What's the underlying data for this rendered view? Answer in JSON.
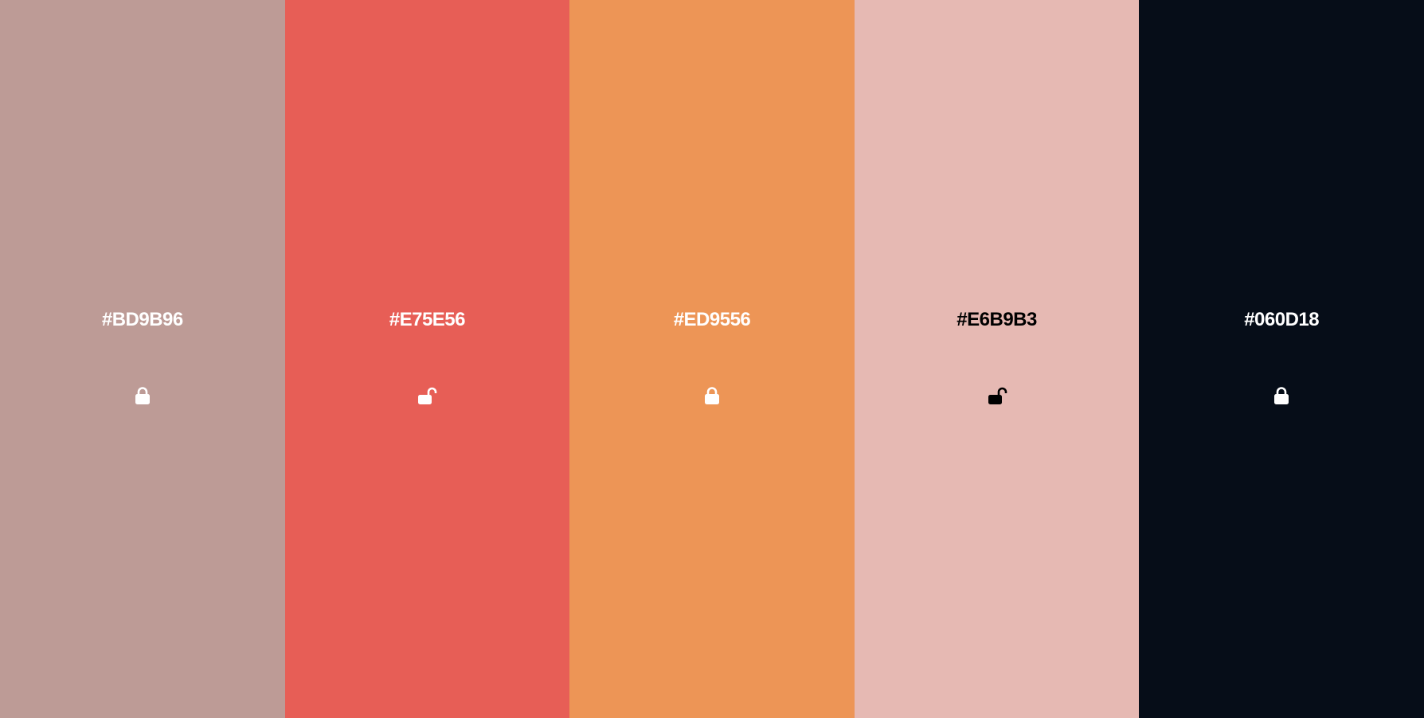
{
  "palette": {
    "swatches": [
      {
        "hex": "#BD9B96",
        "color": "#BD9B96",
        "text_color": "#FFFFFF",
        "lock_state": "locked",
        "lock_icon": "lock-icon"
      },
      {
        "hex": "#E75E56",
        "color": "#E75E56",
        "text_color": "#FFFFFF",
        "lock_state": "unlocked",
        "lock_icon": "unlock-icon"
      },
      {
        "hex": "#ED9556",
        "color": "#ED9556",
        "text_color": "#FFFFFF",
        "lock_state": "locked",
        "lock_icon": "lock-icon"
      },
      {
        "hex": "#E6B9B3",
        "color": "#E6B9B3",
        "text_color": "#000000",
        "lock_state": "unlocked",
        "lock_icon": "unlock-icon"
      },
      {
        "hex": "#060D18",
        "color": "#060D18",
        "text_color": "#FFFFFF",
        "lock_state": "locked",
        "lock_icon": "lock-icon"
      }
    ]
  }
}
